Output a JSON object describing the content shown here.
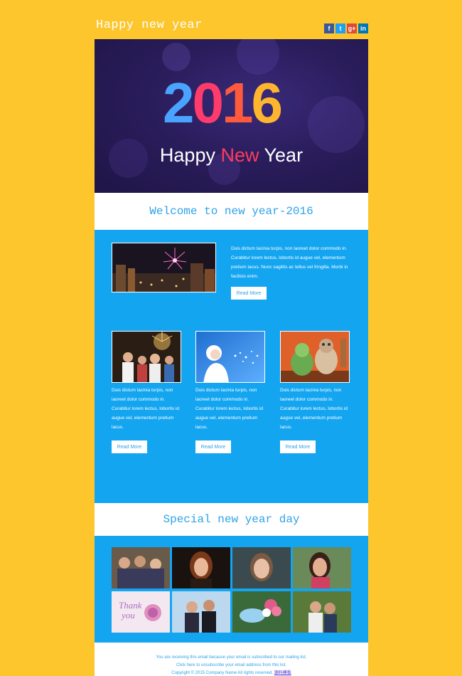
{
  "header": {
    "title": "Happy new year",
    "social": [
      {
        "name": "facebook",
        "glyph": "f",
        "color": "#3b5998"
      },
      {
        "name": "twitter",
        "glyph": "t",
        "color": "#1da1f2"
      },
      {
        "name": "google-plus",
        "glyph": "g+",
        "color": "#dd4b39"
      },
      {
        "name": "linkedin",
        "glyph": "in",
        "color": "#0077b5"
      }
    ]
  },
  "hero": {
    "year_digits": [
      "2",
      "0",
      "1",
      "6"
    ],
    "year_colors": [
      "#4aa3ff",
      "#ff3b6b",
      "#ff5a3c",
      "#ffb62e"
    ],
    "greeting_a": "Happy ",
    "greeting_b": "New",
    "greeting_c": " Year"
  },
  "welcome": {
    "heading": "Welcome to new year-2016",
    "feature_text": "Duis dictum lacinia turpis, non laoreet dolor commodo in. Curabitur lorem lectus, lobortis id augue vel, elementum pretium lacus. Nunc sagittis ac tellus vel fringilla. Morbi in facilisis enim.",
    "feature_button": "Read More",
    "columns": [
      {
        "text": "Duis dictum lacinia turpis, non laoreet dolor commodo in. Curabitur lorem lectus, lobortis id augue vel, elementum pretium lacus.",
        "button": "Read More"
      },
      {
        "text": "Duis dictum lacinia turpis, non laoreet dolor commodo in. Curabitur lorem lectus, lobortis id augue vel, elementum pretium lacus.",
        "button": "Read More"
      },
      {
        "text": "Duis dictum lacinia turpis, non laoreet dolor commodo in. Curabitur lorem lectus, lobortis id augue vel, elementum pretium lacus.",
        "button": "Read More"
      }
    ]
  },
  "special": {
    "heading": "Special new year day"
  },
  "footer": {
    "line1": "You are receiving this email because your email is subscribed to our mailing list.",
    "line2": "Click here to unsubscribe your email address from this list.",
    "line3": "Copyright © 2015 Company Name All rights reserved.",
    "link": "源码模板"
  }
}
